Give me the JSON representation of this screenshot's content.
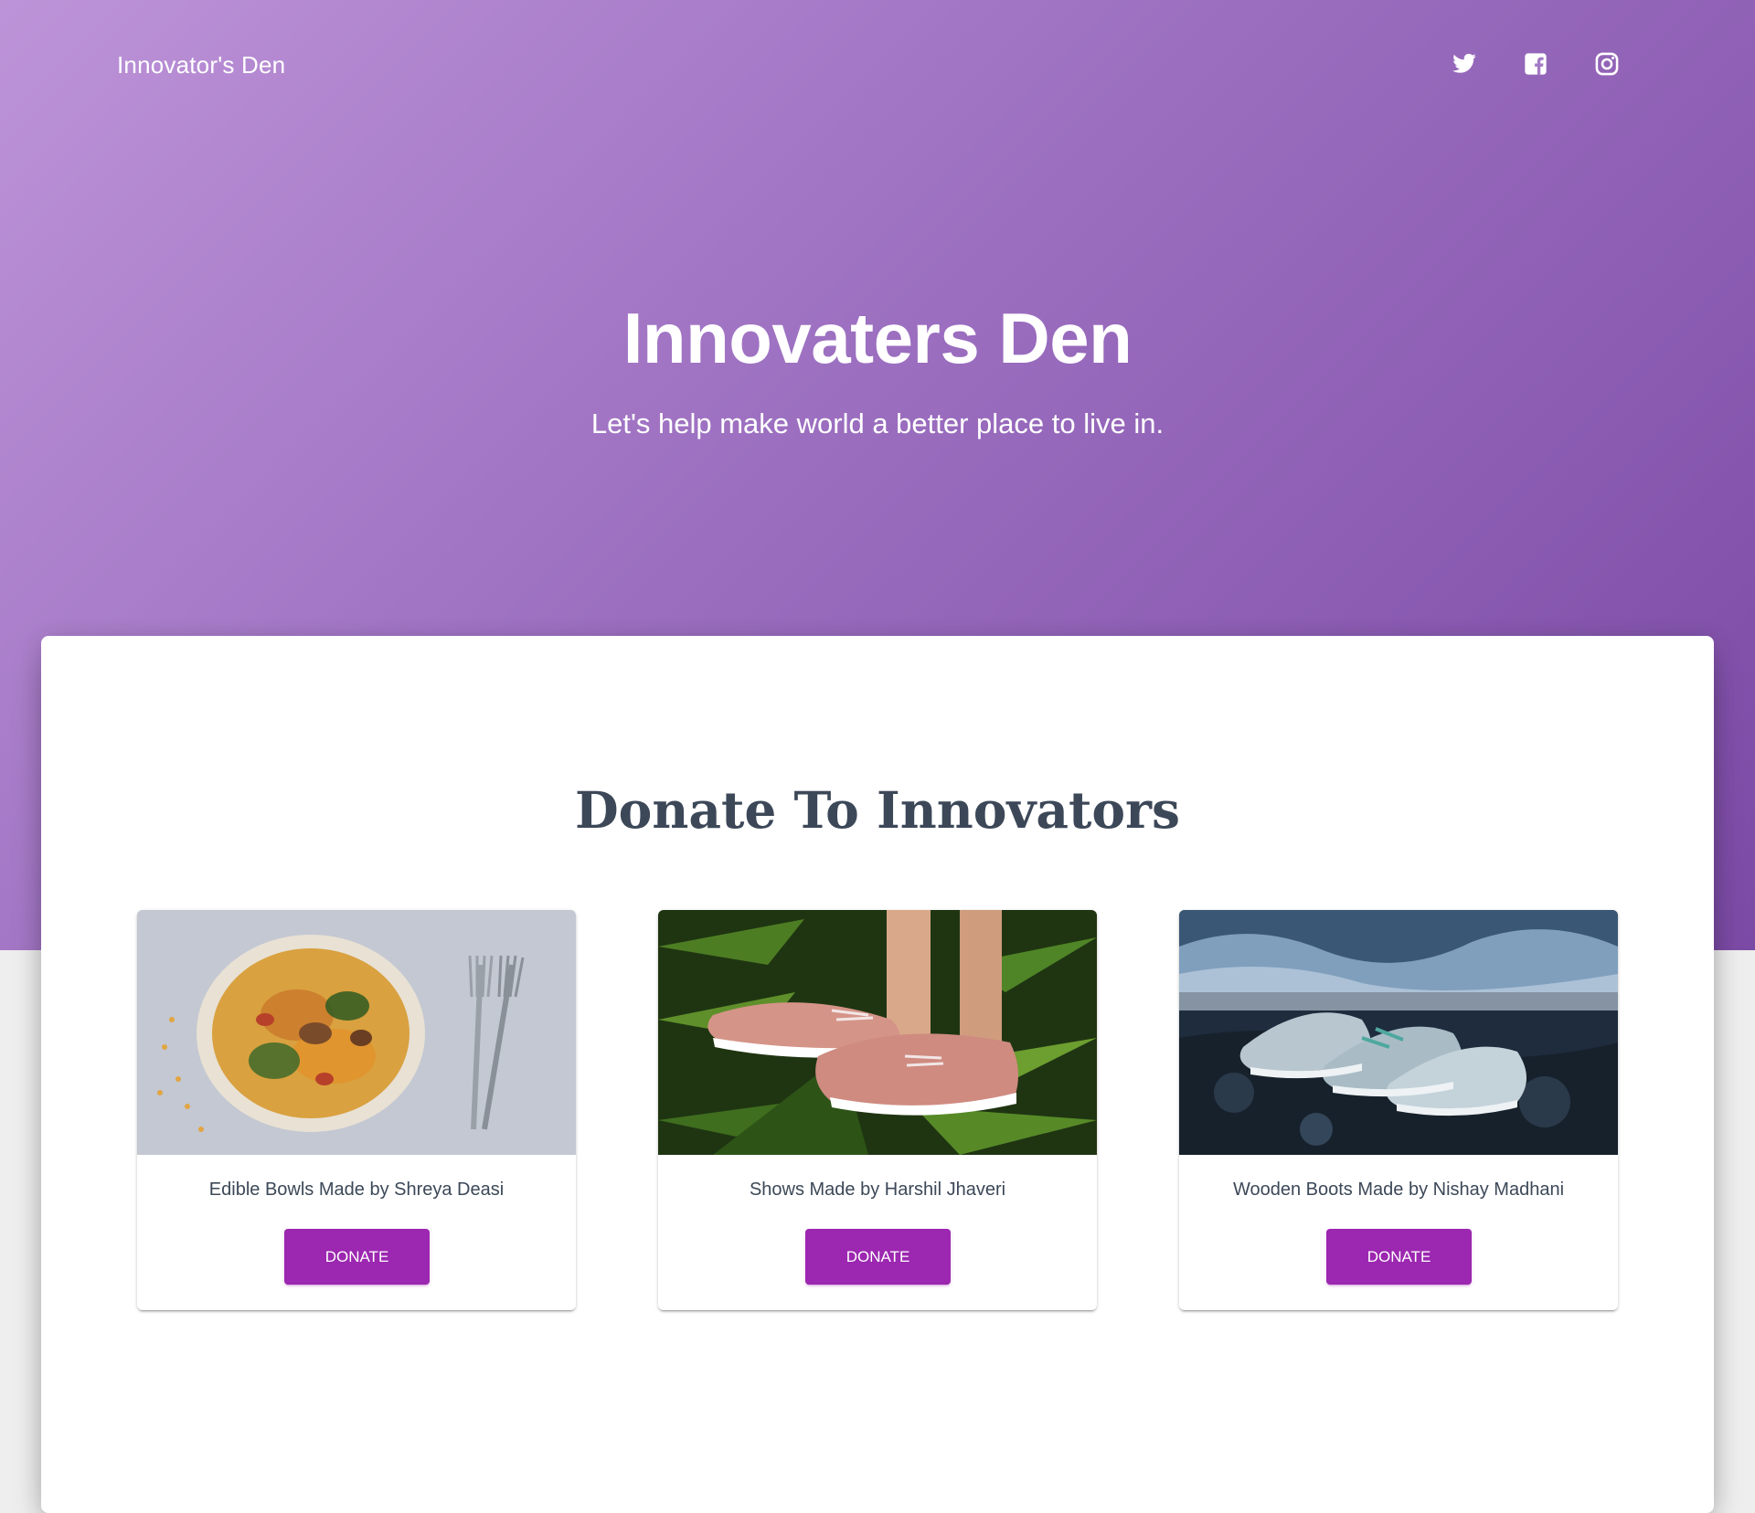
{
  "header": {
    "brand": "Innovator's Den",
    "social_icons": [
      "twitter-icon",
      "facebook-icon",
      "instagram-icon"
    ]
  },
  "hero": {
    "title": "Innovaters Den",
    "subtitle": "Let's help make world a better place to live in."
  },
  "section": {
    "title": "Donate To Innovators",
    "cards": [
      {
        "image": "pasta-bowl-photo",
        "caption": "Edible Bowls Made by Shreya Deasi",
        "button_label": "DONATE"
      },
      {
        "image": "pink-sneakers-photo",
        "caption": "Shows Made by Harshil Jhaveri",
        "button_label": "DONATE"
      },
      {
        "image": "ocean-sneakers-photo",
        "caption": "Wooden Boots Made by Nishay Madhani",
        "button_label": "DONATE"
      }
    ]
  },
  "colors": {
    "hero_gradient_start": "#bd93d8",
    "hero_gradient_end": "#7b4aa5",
    "button": "#9c27b0",
    "heading": "#3c4858",
    "page_background": "#eeeeee"
  }
}
